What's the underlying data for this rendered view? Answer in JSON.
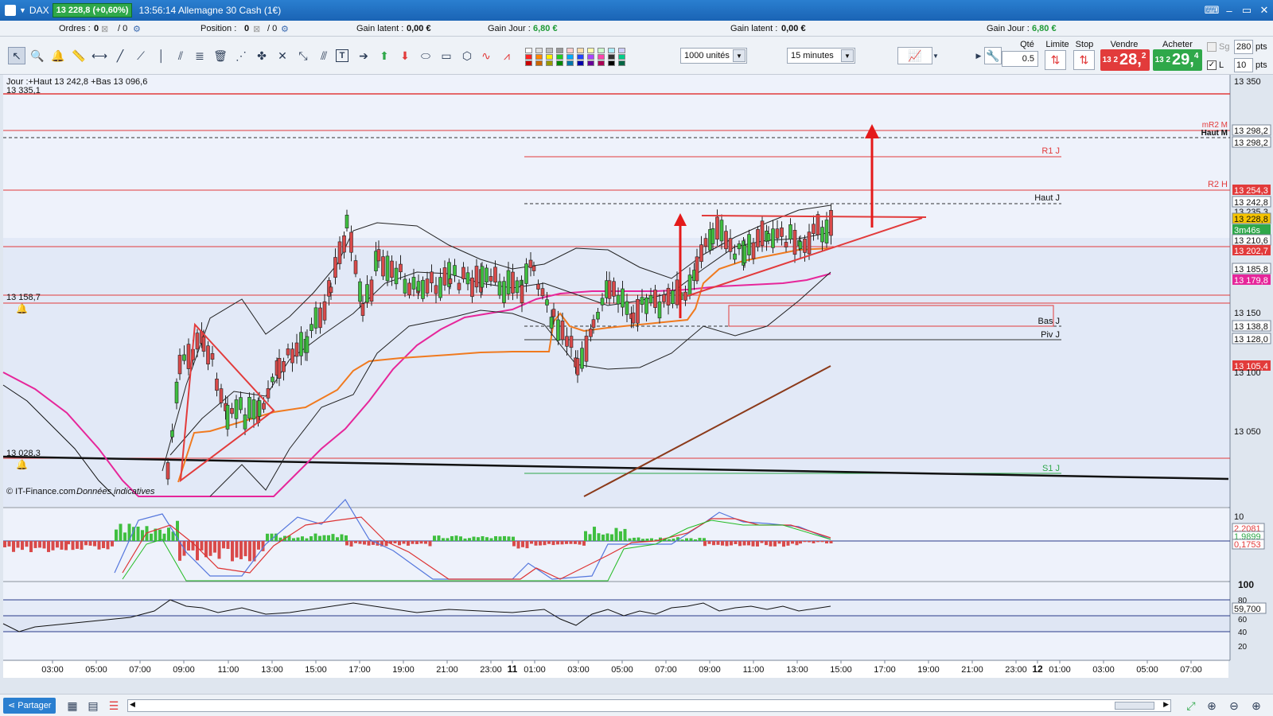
{
  "titlebar": {
    "instrument": "DAX",
    "price_badge": "13 228,8 (+0,60%)",
    "title": "13:56:14 Allemagne 30 Cash (1€)"
  },
  "infobar": {
    "ordres_label": "Ordres :",
    "ordres_value": "0",
    "ordres_value2": "/ 0",
    "position_label": "Position :",
    "position_value": "0",
    "position_value2": "/ 0",
    "gain_latent_label": "Gain latent :",
    "gain_latent_value": "0,00 €",
    "gain_jour_label": "Gain Jour :",
    "gain_jour_value": "6,80 €",
    "gain_latent2_label": "Gain latent :",
    "gain_latent2_value": "0,00 €",
    "gain_jour2_label": "Gain Jour :",
    "gain_jour2_value": "6,80 €"
  },
  "toolbar": {
    "units_select": "1000 unités",
    "timeframe_select": "15 minutes",
    "qty_label": "Qté",
    "qty_value": "0.5",
    "limit_label": "Limite",
    "stop_label": "Stop",
    "sell_label": "Vendre",
    "sell_small": "13 2",
    "sell_big": "28,",
    "sell_sup": "2",
    "buy_label": "Acheter",
    "buy_small": "13 2",
    "buy_big": "29,",
    "buy_sup": "4",
    "sg_label": "Sg",
    "sg_value": "280",
    "l_label": "L",
    "l_value": "10",
    "pts": "pts",
    "sell_color": "#e23b3b",
    "buy_color": "#2fa84a"
  },
  "chart": {
    "header_line": "Jour :+Haut 13 242,8 +Bas 13 096,6",
    "top_left_value": "13 335,1",
    "left_label_158": "13 158,7",
    "left_label_028": "13 028,3",
    "copyright": "© IT-Finance.com",
    "copyright_note": "Données indicatives",
    "level_labels": [
      "R1 J",
      "Haut J",
      "Bas J",
      "Piv J",
      "S1 J",
      "R2 H",
      "mR2 M",
      "Haut M"
    ],
    "price_axis": [
      "13 350",
      "13 298,2",
      "13 298,2",
      "13 254,3",
      "13 242,8",
      "13 235,3",
      "13 228,8",
      "3m46s",
      "13 210,6",
      "13 202,7",
      "13 185,8",
      "13 179,8",
      "13 150",
      "13 138,8",
      "13 128,0",
      "13 105,4",
      "13 100",
      "13 050"
    ],
    "macd_axis": [
      "10",
      "2,2081",
      "1,9899",
      "0,1753"
    ],
    "rsi_axis": [
      "100",
      "80",
      "60",
      "59,700",
      "40",
      "20"
    ],
    "time_axis": [
      "03:00",
      "05:00",
      "07:00",
      "09:00",
      "11:00",
      "13:00",
      "15:00",
      "17:00",
      "19:00",
      "21:00",
      "23:00",
      "11",
      "01:00",
      "03:00",
      "05:00",
      "07:00",
      "09:00",
      "11:00",
      "13:00",
      "15:00",
      "17:00",
      "19:00",
      "21:00",
      "23:00",
      "12",
      "01:00",
      "03:00",
      "05:00",
      "07:00"
    ]
  },
  "bottombar": {
    "share_label": "Partager"
  }
}
